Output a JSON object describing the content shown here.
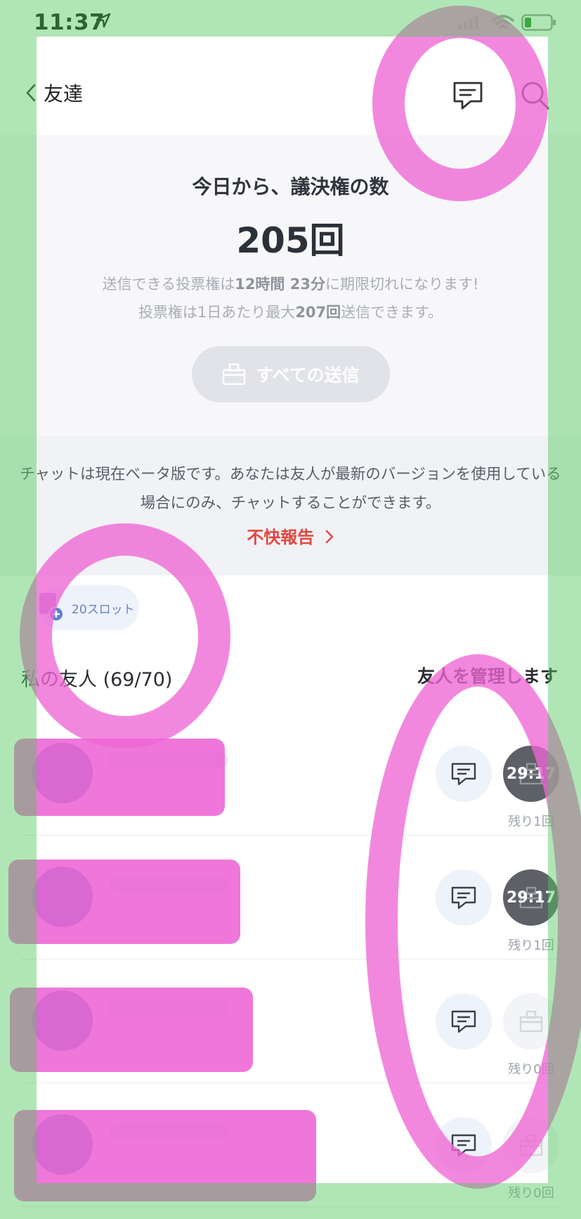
{
  "status_bar": {
    "time": "11:37"
  },
  "nav": {
    "back_label": "友達"
  },
  "vote": {
    "heading": "今日から、議決権の数",
    "count": "205回",
    "info_line1_prefix": "送信できる投票権は",
    "info_line1_bold": "12時間 23分",
    "info_line1_suffix": "に期限切れになります!",
    "info_line2_prefix": "投票権は1日あたり最大",
    "info_line2_bold": "207回",
    "info_line2_suffix": "送信できます。",
    "send_all_label": "すべての送信"
  },
  "beta": {
    "text": "チャットは現在ベータ版です。あなたは友人が最新のバージョンを使用している場合にのみ、チャットすることができます。",
    "report_label": "不快報告"
  },
  "slots": {
    "label": "20スロット"
  },
  "friends": {
    "title": "私の友人 (69/70)",
    "manage_label": "友人を管理します",
    "rows": [
      {
        "timer": "29:17",
        "remaining": "残り1回",
        "state": "active"
      },
      {
        "timer": "29:17",
        "remaining": "残り1回",
        "state": "active"
      },
      {
        "timer": "",
        "remaining": "残り0回",
        "state": "empty"
      },
      {
        "timer": "",
        "remaining": "残り0回",
        "state": "empty"
      }
    ]
  }
}
